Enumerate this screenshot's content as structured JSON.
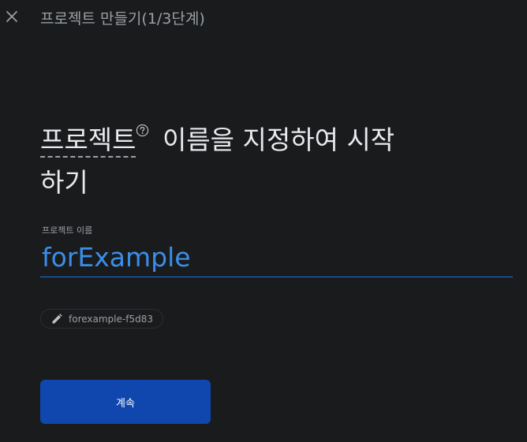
{
  "header": {
    "close_icon": "close-icon",
    "title": "프로젝트 만들기(1/3단계)"
  },
  "heading": {
    "term": "프로젝트",
    "help_icon": "help-circle-icon",
    "rest_line1": " 이름을 지정하여 시작",
    "rest_line2": "하기"
  },
  "form": {
    "label": "프로젝트 이름",
    "value": "forExample",
    "input_color": "#3a8ee8"
  },
  "project_id": {
    "edit_icon": "pencil-icon",
    "text": "forexample-f5d83"
  },
  "actions": {
    "continue_label": "계속",
    "button_color": "#0f47af"
  }
}
